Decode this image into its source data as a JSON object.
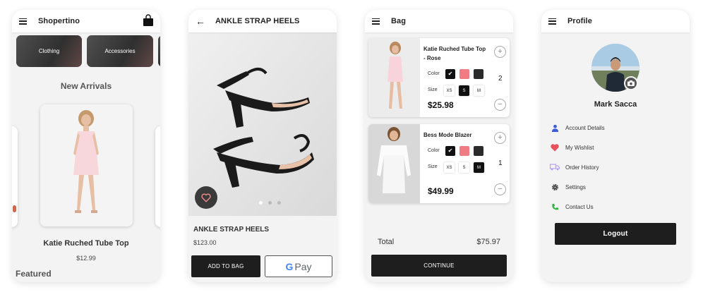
{
  "home": {
    "title": "Shopertino",
    "categories": [
      "Clothing",
      "Accessories"
    ],
    "section_title": "New Arrivals",
    "product_name": "Katie Ruched Tube Top",
    "product_price": "$12.99",
    "featured": "Featured",
    "icons": [
      "menu-icon",
      "shopping-bag-icon"
    ]
  },
  "detail": {
    "title": "ANKLE STRAP HEELS",
    "product_name": "ANKLE STRAP HEELS",
    "price": "$123.00",
    "add_to_bag": "ADD TO BAG",
    "gpay_label": "Pay",
    "gpay_g": "G",
    "carousel_pages": 3,
    "carousel_active": 1,
    "icons": [
      "back-arrow-icon",
      "heart-icon"
    ]
  },
  "bag": {
    "title": "Bag",
    "items": [
      {
        "name": "Katie Ruched Tube Top - Rose",
        "color_label": "Color",
        "size_label": "Size",
        "sizes": [
          "XS",
          "S",
          "M"
        ],
        "selected_size": "S",
        "price": "$25.98",
        "qty": "2",
        "plus": "+",
        "minus": "−"
      },
      {
        "name": "Bess Mode Blazer",
        "color_label": "Color",
        "size_label": "Size",
        "sizes": [
          "XS",
          "S",
          "M"
        ],
        "selected_size": "M",
        "price": "$49.99",
        "qty": "1",
        "plus": "+",
        "minus": "−"
      }
    ],
    "colors": [
      "#111111",
      "#f07b83",
      "#2b2b2b"
    ],
    "total_label": "Total",
    "total_value": "$75.97",
    "continue": "CONTINUE"
  },
  "profile": {
    "title": "Profile",
    "user_name": "Mark Sacca",
    "menu": [
      {
        "label": "Account Details",
        "icon": "person-icon",
        "color": "#3b5bdb"
      },
      {
        "label": "My Wishlist",
        "icon": "heart-icon",
        "color": "#e8505b"
      },
      {
        "label": "Order History",
        "icon": "truck-icon",
        "color": "#b197fc"
      },
      {
        "label": "Settings",
        "icon": "gear-icon",
        "color": "#333333"
      },
      {
        "label": "Contact Us",
        "icon": "phone-icon",
        "color": "#2fb344"
      }
    ],
    "logout": "Logout"
  }
}
